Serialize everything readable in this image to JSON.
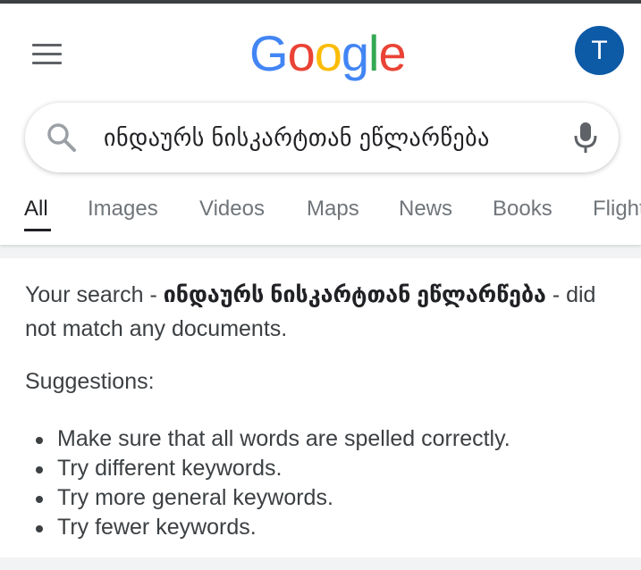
{
  "header": {
    "logo_letters": [
      {
        "char": "G",
        "color": "#4285F4"
      },
      {
        "char": "o",
        "color": "#EA4335"
      },
      {
        "char": "o",
        "color": "#FBBC05"
      },
      {
        "char": "g",
        "color": "#4285F4"
      },
      {
        "char": "l",
        "color": "#34A853"
      },
      {
        "char": "e",
        "color": "#EA4335"
      }
    ],
    "avatar_initial": "T",
    "avatar_color": "#0d5aa7",
    "menu_icon": "hamburger-icon"
  },
  "search": {
    "query": "ინდაურს ნისკარტთან ეწლარწება",
    "search_icon": "search-icon",
    "mic_icon": "microphone-icon"
  },
  "tabs": [
    {
      "label": "All",
      "active": true
    },
    {
      "label": "Images",
      "active": false
    },
    {
      "label": "Videos",
      "active": false
    },
    {
      "label": "Maps",
      "active": false
    },
    {
      "label": "News",
      "active": false
    },
    {
      "label": "Books",
      "active": false
    },
    {
      "label": "Flights",
      "active": false
    }
  ],
  "results": {
    "message_prefix": "Your search - ",
    "query_bold": "ინდაურს ნისკარტთან ეწლარწება",
    "message_suffix": " - did not match any documents.",
    "suggestions_title": "Suggestions:",
    "suggestions": [
      "Make sure that all words are spelled correctly.",
      "Try different keywords.",
      "Try more general keywords.",
      "Try fewer keywords."
    ]
  }
}
